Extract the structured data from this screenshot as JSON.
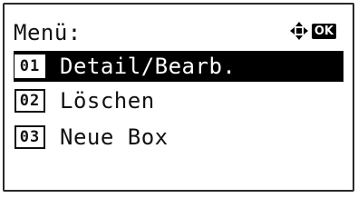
{
  "screen": {
    "title": "Menü:",
    "ok_label": "OK",
    "nav_icon": "four-way-arrow-icon",
    "menu_items": [
      {
        "number": "01",
        "label": "Detail/Bearb.",
        "selected": true
      },
      {
        "number": "02",
        "label": "Löschen",
        "selected": false
      },
      {
        "number": "03",
        "label": "Neue Box",
        "selected": false
      }
    ]
  }
}
